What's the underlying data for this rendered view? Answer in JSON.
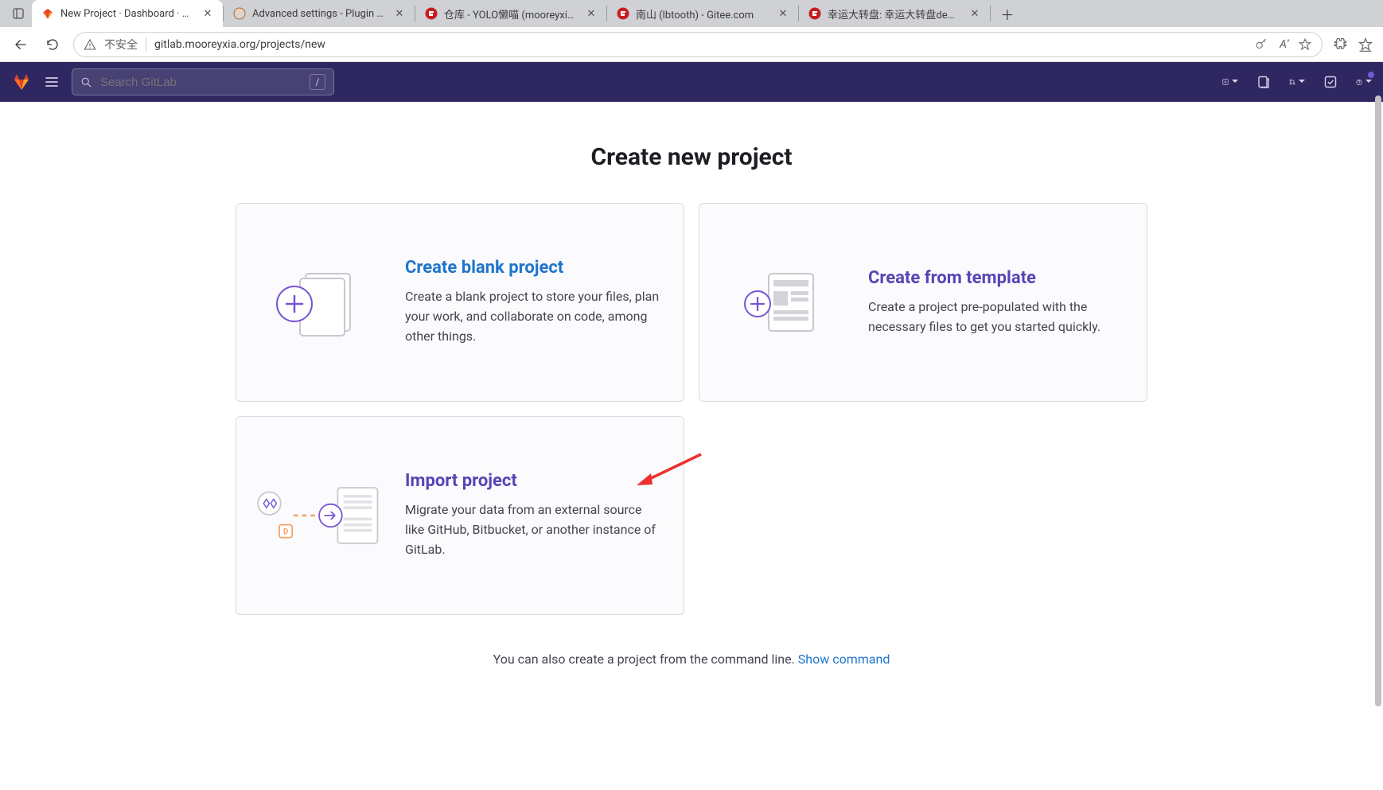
{
  "browser": {
    "tabs": [
      {
        "title": "New Project · Dashboard · GitLab",
        "favicon": "gitlab"
      },
      {
        "title": "Advanced settings - Plugin Mana",
        "favicon": "jenkins"
      },
      {
        "title": "仓库 - YOLO懒喵 (mooreyxia) - G",
        "favicon": "gitee"
      },
      {
        "title": "南山 (lbtooth) - Gitee.com",
        "favicon": "gitee"
      },
      {
        "title": "幸运大转盘: 幸运大转盘demo",
        "favicon": "gitee"
      }
    ],
    "security_label": "不安全",
    "url": "gitlab.mooreyxia.org/projects/new"
  },
  "gitlab_nav": {
    "search_placeholder": "Search GitLab",
    "search_kbd": "/"
  },
  "page": {
    "title": "Create new project",
    "cards": [
      {
        "heading": "Create blank project",
        "desc": "Create a blank project to store your files, plan your work, and collaborate on code, among other things."
      },
      {
        "heading": "Create from template",
        "desc": "Create a project pre-populated with the necessary files to get you started quickly."
      },
      {
        "heading": "Import project",
        "desc": "Migrate your data from an external source like GitHub, Bitbucket, or another instance of GitLab."
      }
    ],
    "footer_text": "You can also create a project from the command line. ",
    "footer_link": "Show command"
  },
  "colors": {
    "gitlab_nav_bg": "#2e2761",
    "link_blue": "#1f75cb",
    "accent_purple": "#5943b6",
    "annotation_red": "#ed2f2f"
  }
}
